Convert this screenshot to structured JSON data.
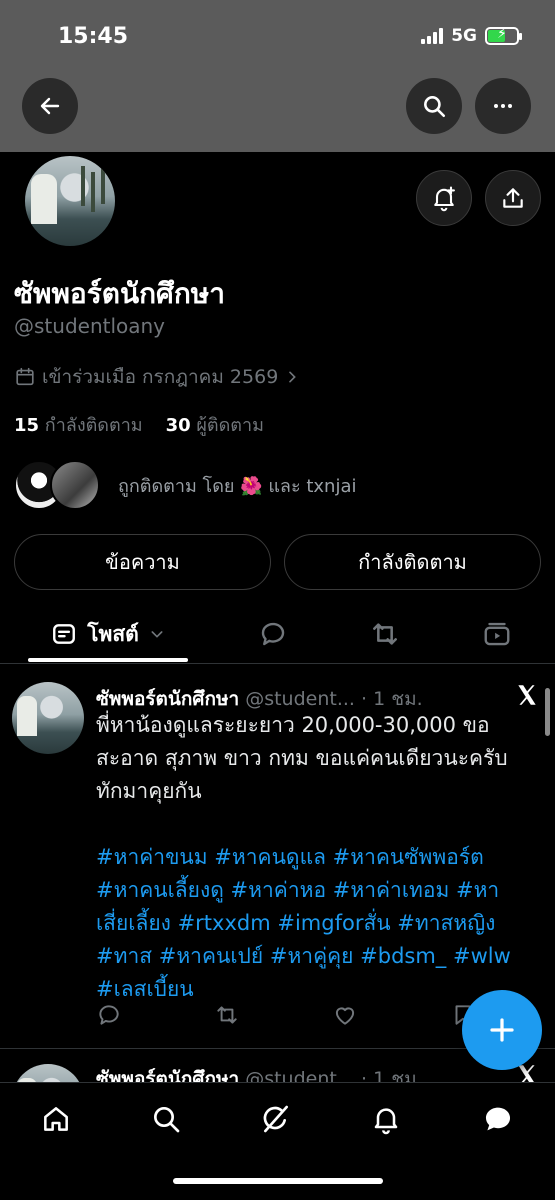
{
  "status": {
    "time": "15:45",
    "network": "5G",
    "battery_level": 0.6
  },
  "profile": {
    "name": "ซัพพอร์ตนักศึกษา",
    "handle": "@studentloany",
    "joined": "เข้าร่วมเมือ กรกฎาคม 2569",
    "following_count": "15",
    "following_label": "กำลังติดตาม",
    "followers_count": "30",
    "followers_label": "ผู้ติดตาม",
    "followed_by": "ถูกติดตาม โดย 🌺 และ txnjai"
  },
  "buttons": {
    "message": "ข้อความ",
    "following": "กำลังติดตาม"
  },
  "tabs": {
    "posts": "โพสต์"
  },
  "posts": [
    {
      "name": "ซัพพอร์ตนักศึกษา",
      "meta": "@student... · 1 ชม.",
      "text_lines": [
        "พี่หาน้องดูแลระยะยาว 20,000-30,000 ขอ",
        "สะอาด สุภาพ ขาว กทม ขอแค่คนเดียวนะครับ",
        "ทักมาคุยกัน"
      ],
      "tag_lines": [
        "#หาค่าขนม #หาคนดูแล #หาคนซัพพอร์ต",
        "#หาคนเลี้ยงดู #หาค่าหอ  #หาค่าเทอม #หา",
        "เสี่ยเลี้ยง #rtxxdm #imgforสั่น #ทาสหญิง",
        "#ทาส #หาคนเปย์ #หาคู่คุย #bdsm_ #wlw",
        "#เลสเบี้ยน"
      ]
    },
    {
      "name": "ซัพพอร์ตนักศึกษา",
      "meta": "@student... · 1 ชม."
    }
  ],
  "colors": {
    "accent": "#1d9bf0",
    "banner": "#5b5b5b",
    "muted": "#71767b"
  },
  "icons": [
    "back-arrow-icon",
    "search-icon",
    "more-icon",
    "notification-bell-icon",
    "share-icon",
    "calendar-icon",
    "chevron-right-icon",
    "posts-icon",
    "chevron-down-icon",
    "reply-icon",
    "repost-icon",
    "media-icon",
    "like-icon",
    "bookmark-icon",
    "x-logo-icon",
    "compose-plus-icon",
    "home-icon",
    "explore-icon",
    "grok-icon",
    "notifications-icon",
    "messages-icon"
  ]
}
